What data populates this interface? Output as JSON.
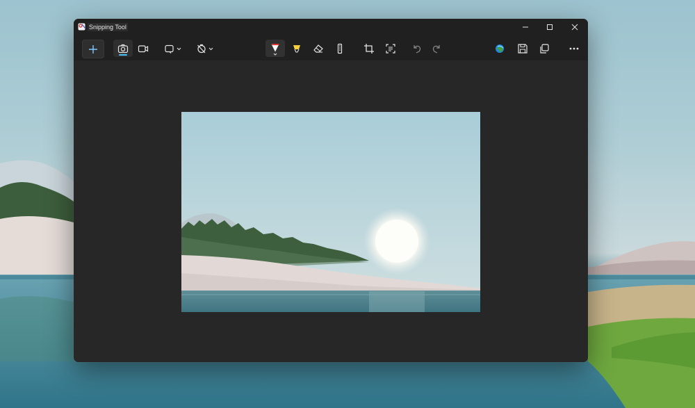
{
  "window": {
    "title": "Snipping Tool",
    "controls": {
      "minimize": "—",
      "maximize": "☐",
      "close": "✕"
    }
  },
  "toolbar": {
    "new_label": "+",
    "mode": {
      "selected": "snip"
    },
    "icons": [
      "plus-icon",
      "camera-icon",
      "video-icon",
      "rectangle-snip-icon",
      "chevron-down-icon",
      "timer-off-icon",
      "chevron-down-icon",
      "ballpoint-pen-icon",
      "highlighter-icon",
      "eraser-icon",
      "ruler-icon",
      "crop-icon",
      "text-actions-icon",
      "undo-icon",
      "redo-icon",
      "edge-icon",
      "save-icon",
      "copy-icon",
      "more-icon"
    ]
  },
  "colors": {
    "window_bg": "#272727",
    "titlebar_bg": "#202020",
    "accent": "#4cc2ff",
    "pen_red": "#e53935",
    "highlighter_yellow": "#f4d03f"
  }
}
